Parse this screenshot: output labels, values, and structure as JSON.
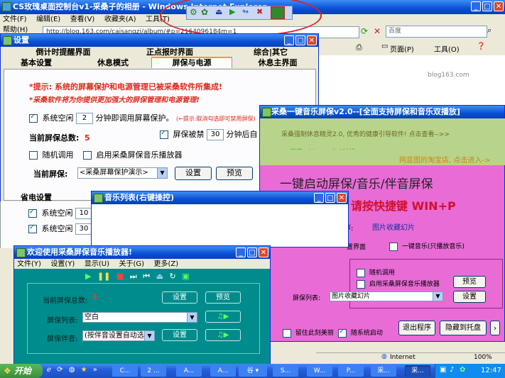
{
  "ie": {
    "title": "CS玫瑰桌面控制台v1-采桑子的相册 - Windows Internet Explorer",
    "menu": [
      "文件(F)",
      "编辑(E)",
      "查看(V)",
      "收藏夹(A)",
      "工具(T)",
      "帮助(H)"
    ],
    "address": "http://blog.163.com/caisangzi/album/#p=2164096184m=1",
    "search_placeholder": "百度",
    "toolbar_page": "页面(P)",
    "toolbar_tools": "工具(O)",
    "blog_text": "blog163.com",
    "status_zone": "Internet",
    "zoom": "100%"
  },
  "settings": {
    "title": "设置",
    "tabs_row1": [
      "倒计时提醒界面",
      "正点报时界面",
      "综合|其它"
    ],
    "tabs_row2": [
      "基本设置",
      "休息模式",
      "屏保与电源",
      "休息主界面"
    ],
    "hint1": "*提示: 系统的屏幕保护和电源管理已被采桑软件所集成!",
    "hint2": "*采桑软件将为你提供更加强大的屏保管理和电源管理!",
    "idle_label": "系统空闲",
    "idle_value": "2",
    "idle_suffix": "分钟即调用屏幕保护。",
    "idle_tip": "(←提示:取消勾选即可禁用屏保)",
    "count_label": "当前屏保总数:",
    "count_value": "5",
    "disable_label": "屏保被禁",
    "disable_value": "30",
    "disable_suffix": "分钟后自",
    "random_label": "随机调用",
    "music_label": "启用采桑屏保音乐播放器",
    "current_label": "当前屏保:",
    "current_value": "<采桑屏幕保护演示>",
    "btn_setting": "设置",
    "btn_preview": "预览",
    "power_title": "省电设置",
    "power_idle1_label": "系统空闲",
    "power_idle1_value": "10",
    "power_idle2_label": "系统空闲",
    "power_idle2_value": "30"
  },
  "music_list": {
    "title": "音乐列表(右键操控)"
  },
  "player": {
    "title": "欢迎使用采桑屏保音乐播放器!",
    "menu": [
      "文件(Y)",
      "设置(Y)",
      "显示(U)",
      "关于(G)",
      "更多(Z)"
    ],
    "count_label": "当前屏保总数:",
    "count_value": "4",
    "list_label": "屏保列表:",
    "list_value": "空白",
    "companion_label": "屏保伴音:",
    "companion_value": "(按伴音设置自动选择)",
    "btn_setting": "设置",
    "btn_preview": "预览",
    "btn_setting2": "设置"
  },
  "pink": {
    "title": "采桑一键音乐屏保v2.0--[全面支持屏保和音乐双播放]",
    "banner_line1": "采桑强制休息精灵2.0, 优秀的健康引导软件! 点击查看-->>",
    "banner_line2": "健康+10<<<3.0时代",
    "banner_link": "网蓝图的淘宝店, 点击进入->",
    "headline": "一键启动屏保/音乐/伴音屏保",
    "hotkey": "请按快捷键 WIN+P",
    "current_suffix": "序:",
    "current_value": "图片收藏幻片",
    "screen_label": "置界面",
    "one_key_music": "一键音乐(只播放音乐)",
    "random_label": "随机调用",
    "enable_music": "启用采桑屏保音乐播放器",
    "btn_preview": "预览",
    "list_label": "屏保列表:",
    "list_value": "图片收藏幻片",
    "btn_setting": "设置",
    "keep_label": "留住此刻美丽",
    "startup_label": "随系统启动",
    "btn_exit": "退出程序",
    "btn_hide": "隐藏到托盘",
    "btn_more": "›"
  },
  "taskbar": {
    "start": "开始",
    "items": [
      "C...",
      "2 ...",
      "A...",
      "A...",
      "谷 ▾",
      "S...",
      "W...",
      "P...",
      "采...",
      "采..."
    ],
    "clock": "12:47"
  },
  "colors": {
    "xp_blue": "#0a4fd4",
    "teal_player": "#008c8c",
    "pink_bg": "#e86bd6",
    "red_annotation": "#d9232e",
    "hint_red": "#e0281a"
  }
}
